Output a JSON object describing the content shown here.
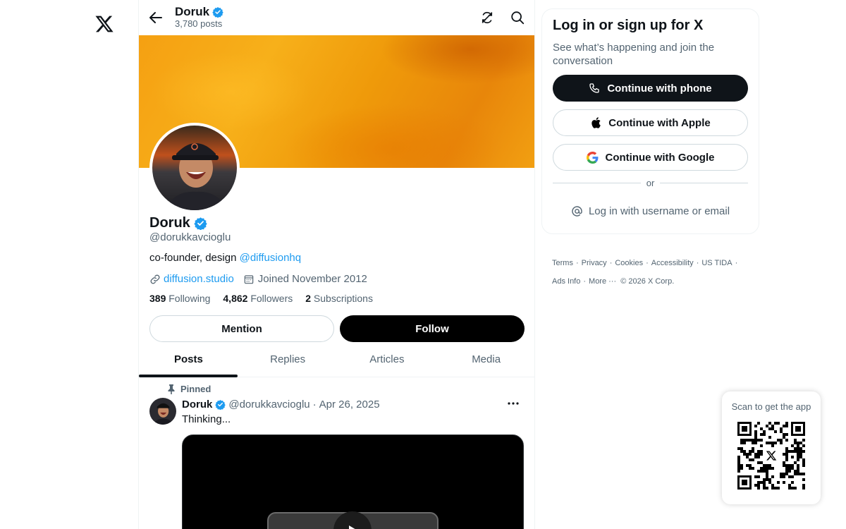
{
  "header": {
    "name": "Doruk",
    "posts_count": "3,780 posts"
  },
  "profile": {
    "name": "Doruk",
    "handle": "@dorukkavcioglu",
    "bio_text": "co-founder, design ",
    "bio_mention": "@diffusionhq",
    "website": "diffusion.studio",
    "joined": "Joined November 2012",
    "following_count": "389",
    "following_label": "Following",
    "followers_count": "4,862",
    "followers_label": "Followers",
    "subscriptions_count": "2",
    "subscriptions_label": "Subscriptions",
    "mention_button": "Mention",
    "follow_button": "Follow"
  },
  "tabs": [
    {
      "label": "Posts",
      "active": true
    },
    {
      "label": "Replies",
      "active": false
    },
    {
      "label": "Articles",
      "active": false
    },
    {
      "label": "Media",
      "active": false
    }
  ],
  "post": {
    "pinned_label": "Pinned",
    "author": "Doruk",
    "handle": "@dorukkavcioglu",
    "dot": "·",
    "date": "Apr 26, 2025",
    "text": "Thinking..."
  },
  "signup": {
    "title": "Log in or sign up for X",
    "subtitle": "See what’s happening and join the conversation",
    "phone_button": "Continue with phone",
    "apple_button": "Continue with Apple",
    "google_button": "Continue with Google",
    "or_label": "or",
    "username_login": "Log in with username or email"
  },
  "footer": {
    "links": [
      "Terms",
      "Privacy",
      "Cookies",
      "Accessibility",
      "US TIDA",
      "Ads Info",
      "More ···"
    ],
    "copyright": "© 2026 X Corp."
  },
  "qr": {
    "label": "Scan to get the app"
  },
  "colors": {
    "accent": "#1d9bf0",
    "text": "#0f1419",
    "muted": "#536471",
    "border": "#eff3f4"
  },
  "icons": [
    "x-logo-icon",
    "back-arrow-icon",
    "verified-badge-icon",
    "refresh-icon",
    "search-icon",
    "link-icon",
    "calendar-icon",
    "pin-icon",
    "more-icon",
    "phone-icon",
    "apple-icon",
    "google-icon",
    "at-icon",
    "play-icon",
    "qr-code-icon"
  ]
}
